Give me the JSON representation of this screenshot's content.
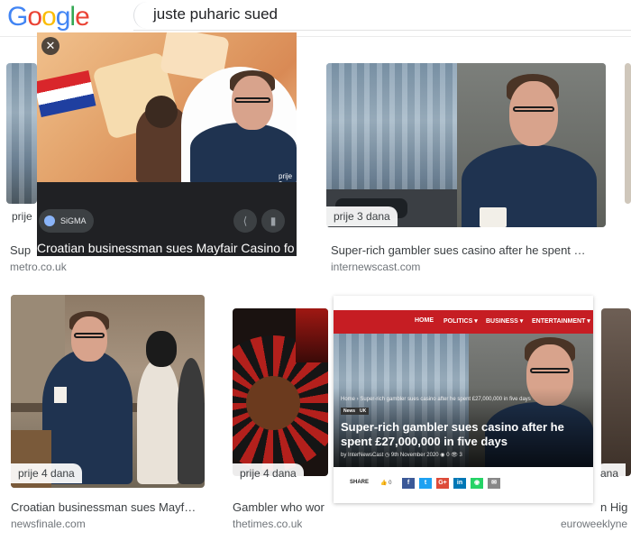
{
  "header": {
    "logo_letters": [
      "G",
      "o",
      "o",
      "g",
      "l",
      "e"
    ],
    "logo_colors": [
      "#4285F4",
      "#EA4335",
      "#FBBC05",
      "#4285F4",
      "#34A853",
      "#EA4335"
    ],
    "search_query": "juste puharic sued"
  },
  "popup": {
    "close_icon": "close-icon",
    "source_chip": "SiGMA",
    "timestamp_partial": "prije 9",
    "title": "Croatian businessman sues Mayfair Casino fo",
    "actions": [
      "share-icon",
      "bookmark-icon"
    ]
  },
  "results": [
    {
      "title": "Sup",
      "source": "metro.co.uk",
      "time": "prije"
    },
    {
      "title": "Super-rich gambler sues casino after he spent …",
      "source": "internewscast.com",
      "time": "prije 3 dana"
    },
    {
      "title": "Croatian businessman sues Mayf…",
      "source": "newsfinale.com",
      "time": "prije 4 dana"
    },
    {
      "title": "Gambler who wor",
      "source": "thetimes.co.uk",
      "time": "prije 4 dana"
    },
    {
      "title": "n Hig",
      "source": "euroweeklyne",
      "time": "ana"
    }
  ],
  "news_overlay": {
    "nav": [
      "HOME",
      "POLITICS ▾",
      "BUSINESS ▾",
      "ENTERTAINMENT ▾"
    ],
    "breadcrumb": "Home › Super-rich gambler sues casino after he spent £27,000,000 in five days",
    "badges": [
      "News",
      "UK"
    ],
    "headline": "Super-rich gambler sues casino after he spent £27,000,000 in five days",
    "byline": "by InterNewsCast  ◷ 9th November 2020  ◉ 0  👁 3",
    "share_label": "SHARE",
    "share_count": "👍 0",
    "share_buttons": [
      {
        "label": "f",
        "color": "#3b5998"
      },
      {
        "label": "t",
        "color": "#1da1f2"
      },
      {
        "label": "G+",
        "color": "#dd4b39"
      },
      {
        "label": "in",
        "color": "#0077b5"
      },
      {
        "label": "◉",
        "color": "#25d366"
      },
      {
        "label": "✉",
        "color": "#888888"
      }
    ]
  }
}
